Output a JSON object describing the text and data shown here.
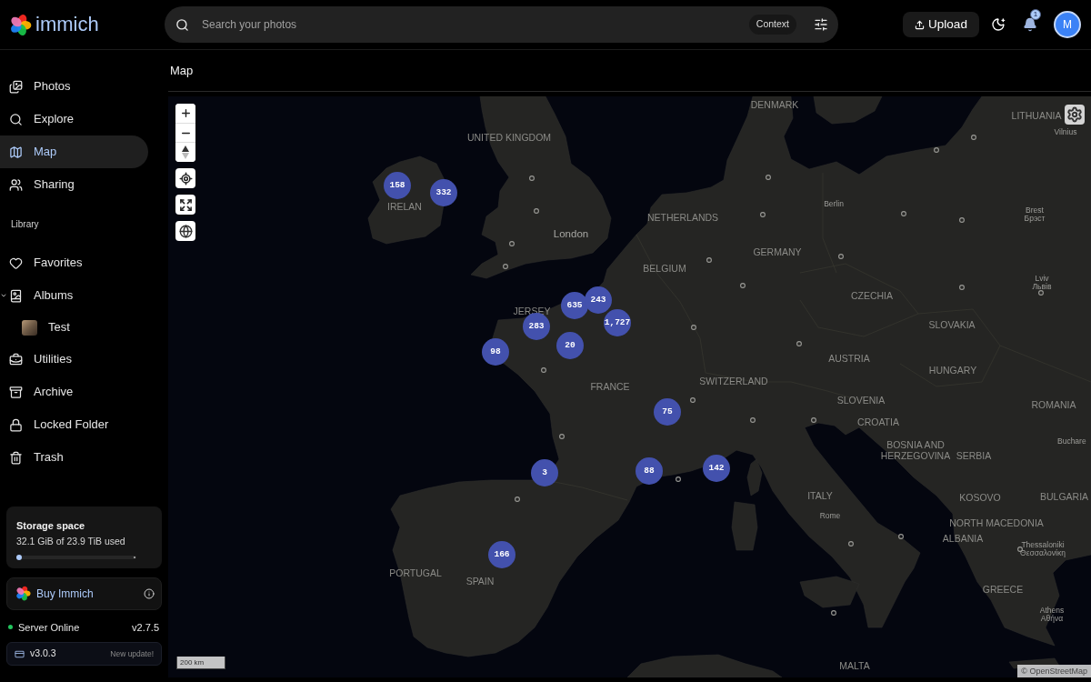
{
  "header": {
    "logo_text": "immich",
    "search_placeholder": "Search your photos",
    "search_mode": "Context",
    "upload_label": "Upload",
    "notification_count": "1",
    "avatar_initial": "M"
  },
  "sidebar": {
    "nav": [
      {
        "label": "Photos",
        "selected": false
      },
      {
        "label": "Explore",
        "selected": false
      },
      {
        "label": "Map",
        "selected": true
      },
      {
        "label": "Sharing",
        "selected": false
      }
    ],
    "library_heading": "Library",
    "library": [
      {
        "label": "Favorites",
        "selected": false
      },
      {
        "label": "Albums",
        "selected": false,
        "expanded": true,
        "children": [
          {
            "label": "Test",
            "selected": false
          }
        ]
      },
      {
        "label": "Utilities",
        "selected": false
      },
      {
        "label": "Archive",
        "selected": false
      },
      {
        "label": "Locked Folder",
        "selected": false
      },
      {
        "label": "Trash",
        "selected": false
      }
    ],
    "storage": {
      "title": "Storage space",
      "usage": "32.1 GiB of 23.9 TiB used",
      "level": 0.0013
    },
    "buy": {
      "label": "Buy Immich"
    },
    "server": {
      "status": "Server Online",
      "online": true,
      "version": "v2.7.5"
    },
    "update": {
      "version": "v3.0.3",
      "note": "New update!"
    }
  },
  "page": {
    "title": "Map"
  },
  "map": {
    "clusters": [
      {
        "count": "158"
      },
      {
        "count": "332"
      },
      {
        "count": "635"
      },
      {
        "count": "243"
      },
      {
        "count": "283"
      },
      {
        "count": "1,727"
      },
      {
        "count": "98"
      },
      {
        "count": "20"
      },
      {
        "count": "75"
      },
      {
        "count": "3"
      },
      {
        "count": "88"
      },
      {
        "count": "142"
      },
      {
        "count": "166"
      }
    ],
    "labels": [
      {
        "kind": "country",
        "lines": [
          "DENMARK"
        ]
      },
      {
        "kind": "country",
        "lines": [
          "LITHUANIA"
        ]
      },
      {
        "kind": "city",
        "lines": [
          "Vilnius"
        ]
      },
      {
        "kind": "country",
        "lines": [
          "UNITED KINGDOM"
        ]
      },
      {
        "kind": "country",
        "lines": [
          "IRELAN"
        ]
      },
      {
        "kind": "city",
        "lines": [
          "Berlin"
        ]
      },
      {
        "kind": "city",
        "lines": [
          "Brest",
          "Брэст"
        ]
      },
      {
        "kind": "country",
        "lines": [
          "NETHERLANDS"
        ]
      },
      {
        "kind": "major_city",
        "lines": [
          "London"
        ]
      },
      {
        "kind": "country",
        "lines": [
          "GERMANY"
        ]
      },
      {
        "kind": "country",
        "lines": [
          "BELGIUM"
        ]
      },
      {
        "kind": "city",
        "lines": [
          "Lviv",
          "Львів"
        ]
      },
      {
        "kind": "country",
        "lines": [
          "CZECHIA"
        ]
      },
      {
        "kind": "country",
        "lines": [
          "JERSEY"
        ]
      },
      {
        "kind": "country",
        "lines": [
          "SLOVAKIA"
        ]
      },
      {
        "kind": "country",
        "lines": [
          "AUSTRIA"
        ]
      },
      {
        "kind": "country",
        "lines": [
          "HUNGARY"
        ]
      },
      {
        "kind": "country",
        "lines": [
          "SWITZERLAND"
        ]
      },
      {
        "kind": "country",
        "lines": [
          "FRANCE"
        ]
      },
      {
        "kind": "country",
        "lines": [
          "SLOVENIA"
        ]
      },
      {
        "kind": "country",
        "lines": [
          "ROMANIA"
        ]
      },
      {
        "kind": "country",
        "lines": [
          "CROATIA"
        ]
      },
      {
        "kind": "city",
        "lines": [
          "Buchare"
        ]
      },
      {
        "kind": "country",
        "lines": [
          "BOSNIA AND",
          "HERZEGOVINA"
        ]
      },
      {
        "kind": "country",
        "lines": [
          "SERBIA"
        ]
      },
      {
        "kind": "country",
        "lines": [
          "ITALY"
        ]
      },
      {
        "kind": "country",
        "lines": [
          "KOSOVO"
        ]
      },
      {
        "kind": "country",
        "lines": [
          "BULGARIA"
        ]
      },
      {
        "kind": "city",
        "lines": [
          "Rome"
        ]
      },
      {
        "kind": "country",
        "lines": [
          "NORTH MACEDONIA"
        ]
      },
      {
        "kind": "country",
        "lines": [
          "ALBANIA"
        ]
      },
      {
        "kind": "city",
        "lines": [
          "Thessaloniki",
          "Θεσσαλονίκη"
        ]
      },
      {
        "kind": "country",
        "lines": [
          "PORTUGAL"
        ]
      },
      {
        "kind": "country",
        "lines": [
          "SPAIN"
        ]
      },
      {
        "kind": "country",
        "lines": [
          "GREECE"
        ]
      },
      {
        "kind": "city",
        "lines": [
          "Athens",
          "Αθήνα"
        ]
      },
      {
        "kind": "country",
        "lines": [
          "MALTA"
        ]
      }
    ],
    "scale": "200 km",
    "attribution": "© OpenStreetMap"
  }
}
